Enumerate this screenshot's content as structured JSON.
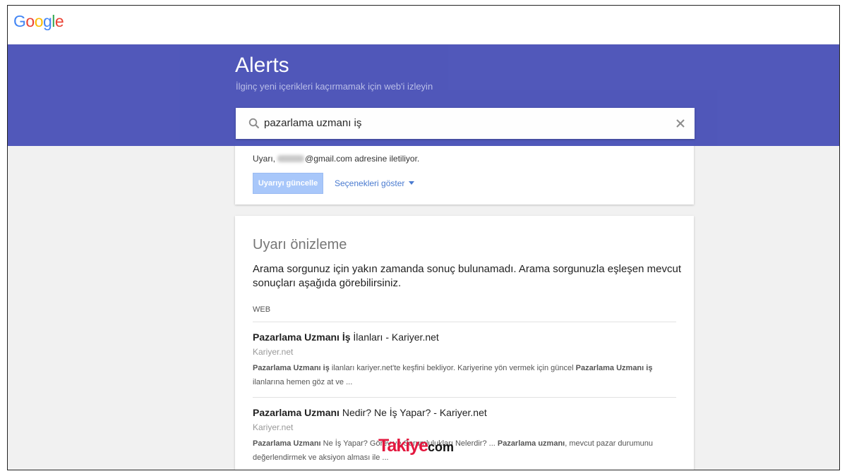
{
  "header": {
    "logo_letters": [
      {
        "ch": "G",
        "color": "#4285f4"
      },
      {
        "ch": "o",
        "color": "#ea4335"
      },
      {
        "ch": "o",
        "color": "#fbbc05"
      },
      {
        "ch": "g",
        "color": "#4285f4"
      },
      {
        "ch": "l",
        "color": "#34a853"
      },
      {
        "ch": "e",
        "color": "#ea4335"
      }
    ]
  },
  "banner": {
    "title": "Alerts",
    "subtitle": "İlginç yeni içerikleri kaçırmamak için web'i izleyin",
    "color": "#4b53b8"
  },
  "search": {
    "value": "pazarlama uzmanı iş",
    "icon": "search-icon",
    "clear_icon": "close-icon"
  },
  "delivery": {
    "prefix": "Uyarı,",
    "suffix": "@gmail.com adresine iletiliyor.",
    "update_label": "Uyarıyı güncelle",
    "options_label": "Seçenekleri göster"
  },
  "preview": {
    "title": "Uyarı önizleme",
    "message": "Arama sorgunuz için yakın zamanda sonuç bulunamadı. Arama sorgunuzla eşleşen mevcut sonuçları aşağıda görebilirsiniz.",
    "section_label": "WEB",
    "results": [
      {
        "title_bold": "Pazarlama Uzmanı İş",
        "title_rest": " İlanları - Kariyer.net",
        "source": "Kariyer.net",
        "snippet_parts": [
          {
            "b": true,
            "t": "Pazarlama Uzmanı iş"
          },
          {
            "b": false,
            "t": " ilanları kariyer.net'te keşfini bekliyor. Kariyerine yön vermek için güncel "
          },
          {
            "b": true,
            "t": "Pazarlama Uzmanı iş"
          },
          {
            "b": false,
            "t": " ilanlarına hemen göz at ve ..."
          }
        ]
      },
      {
        "title_bold": "Pazarlama Uzmanı",
        "title_rest": " Nedir? Ne İş Yapar? - Kariyer.net",
        "source": "Kariyer.net",
        "snippet_parts": [
          {
            "b": true,
            "t": "Pazarlama Uzmanı"
          },
          {
            "b": false,
            "t": " Ne İş Yapar? Görev ve Sorumlulukları Nelerdir? ... "
          },
          {
            "b": true,
            "t": "Pazarlama uzmanı"
          },
          {
            "b": false,
            "t": ", mevcut pazar durumunu değerlendirmek ve aksiyon alması ile ..."
          }
        ]
      }
    ]
  },
  "watermark": {
    "main": "Takiye",
    "suffix": "com"
  }
}
